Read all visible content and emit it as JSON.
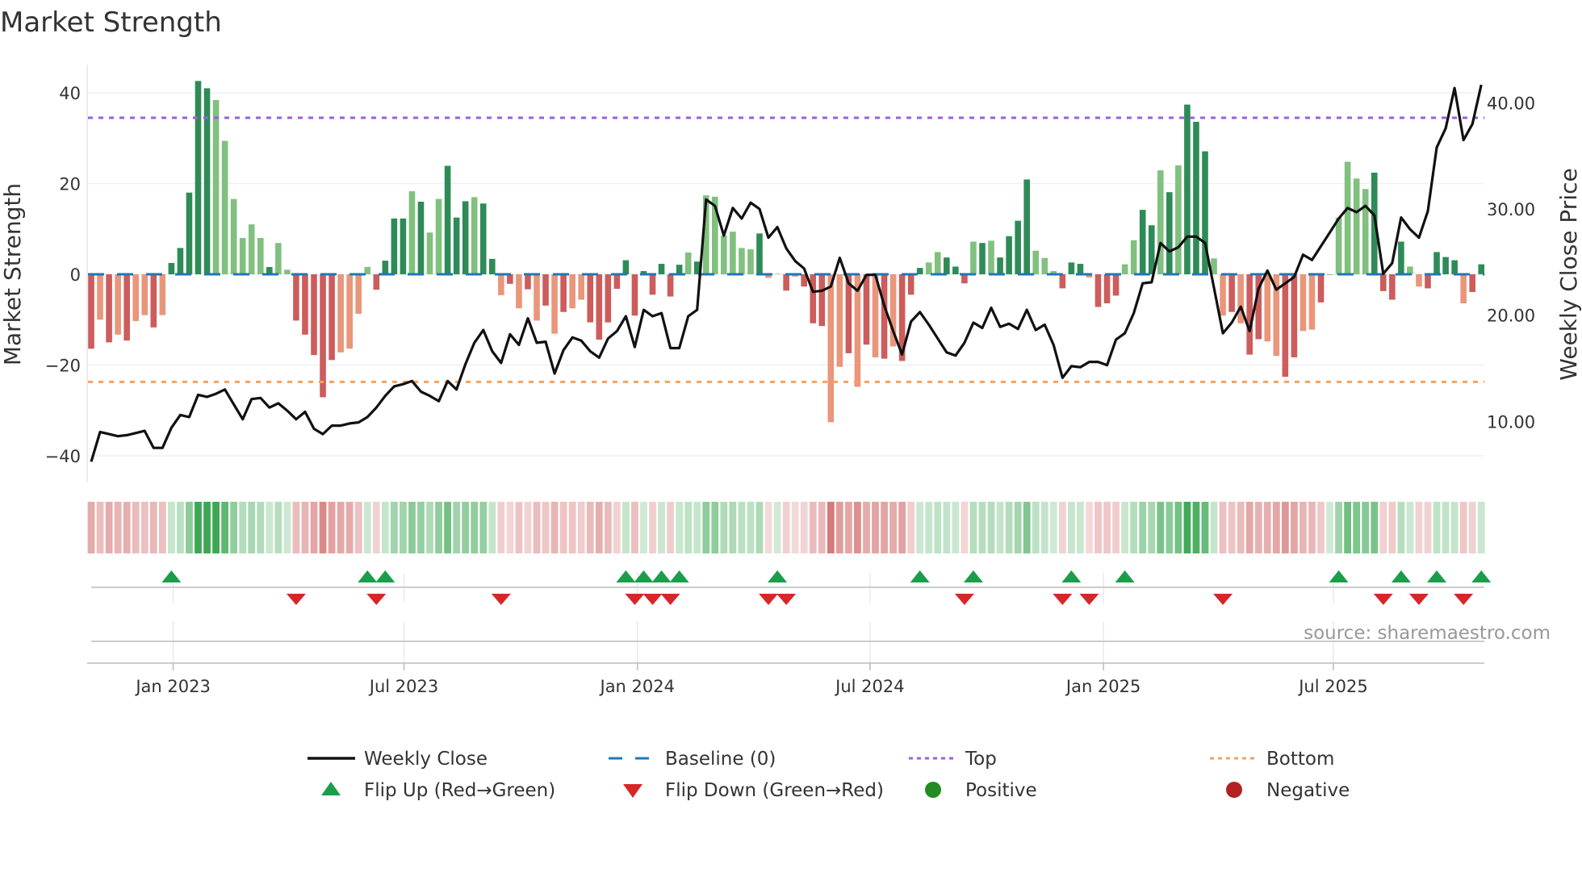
{
  "title": "Market Strength",
  "source": "source: sharemaestro.com",
  "colors": {
    "pos_dark": "#2e8b57",
    "pos_light": "#81c07f",
    "neg_dark": "#cd5c5c",
    "neg_light": "#e9967a",
    "baseline": "#1f77b4",
    "top": "#9b5de5",
    "bottom": "#f4a261",
    "close": "#111111",
    "flip_up": "#1a9e4a",
    "flip_down": "#d62728",
    "positive": "#228b22",
    "negative": "#b22222"
  },
  "chart_data": {
    "type": "bar",
    "title": "Market Strength",
    "ylabel": "Market Strength",
    "y2label": "Weekly Close Price",
    "ylim": [
      -45,
      45
    ],
    "y2lim": [
      5.3,
      48.1
    ],
    "yticks": [
      -40,
      -20,
      0,
      20,
      40
    ],
    "y2ticks": [
      "10.00",
      "20.00",
      "30.00",
      "40.00"
    ],
    "xticks": [
      {
        "label": "Jan 2023",
        "week": 9.2
      },
      {
        "label": "Jul 2023",
        "week": 35.1
      },
      {
        "label": "Jan 2024",
        "week": 61.3
      },
      {
        "label": "Jul 2024",
        "week": 87.4
      },
      {
        "label": "Jan 2025",
        "week": 113.6
      },
      {
        "label": "Jul 2025",
        "week": 139.4
      }
    ],
    "top_level": 34.5,
    "bottom_level": -23.7,
    "baseline": 0,
    "strength": [
      -16.4,
      -10,
      -15,
      -13.3,
      -14.6,
      -10.3,
      -9,
      -11.7,
      -9,
      2.5,
      5.8,
      18,
      42.6,
      41,
      38.4,
      29.4,
      16.6,
      8,
      11,
      8,
      1.6,
      6.9,
      1,
      -10.2,
      -13.3,
      -17.8,
      -27.1,
      -18.9,
      -17.2,
      -16.4,
      -8.7,
      1.6,
      -3.4,
      3,
      12.3,
      12.3,
      18.3,
      16,
      9.2,
      16.6,
      23.9,
      12.5,
      16.1,
      17,
      15.6,
      3.4,
      -4.6,
      -2.1,
      -7.5,
      -3.3,
      -10.2,
      -6.9,
      -13.1,
      -8.3,
      -7.5,
      -5.6,
      -10.6,
      -14.4,
      -10.6,
      -3.2,
      3.1,
      -9.1,
      0.7,
      -4.5,
      2.3,
      -4.9,
      2.1,
      4.8,
      2.8,
      17.4,
      17.1,
      8.5,
      9.4,
      5.8,
      5.5,
      9,
      -0.8,
      0.1,
      -3.6,
      -0.5,
      -2.7,
      -10.8,
      -11.4,
      -32.6,
      -20.4,
      -17.4,
      -24.8,
      -15.5,
      -18.3,
      -18.6,
      -15.9,
      -19.1,
      -4.5,
      1.4,
      2.6,
      4.9,
      3.7,
      1.7,
      -2,
      7.2,
      6.9,
      7.4,
      3.7,
      8.4,
      11.8,
      20.9,
      5.2,
      3.6,
      0.7,
      -3.1,
      2.6,
      2.3,
      -0.7,
      -7.2,
      -6.4,
      -4.7,
      2.2,
      7.5,
      14.2,
      10.8,
      22.9,
      18.1,
      24,
      37.4,
      33.6,
      27.1,
      3.5,
      -9.1,
      -8.3,
      -10.8,
      -17.7,
      -14.3,
      -14.8,
      -18,
      -22.6,
      -18.3,
      -12.5,
      -12.2,
      -6.2,
      0,
      12.5,
      24.8,
      21.1,
      18.8,
      22.4,
      -3.7,
      -5.6,
      7.2,
      1.7,
      -2.7,
      -3.1,
      4.9,
      3.8,
      3.1,
      -6.4,
      -3.9,
      2.2
    ],
    "shade": "dldldlldldddddlllllldlldddddllllddddldlldddlddldldldldlldddddddddddldlllllldlldldddlldldldldddlldddldlddddllldddldddllddldldddlldlddllddllddllllddddllddddlddddlldld",
    "weekly_close": [
      6.2,
      9.0,
      8.8,
      8.6,
      8.7,
      8.9,
      9.1,
      7.5,
      7.5,
      9.4,
      10.6,
      10.4,
      12.5,
      12.3,
      12.6,
      13.0,
      11.6,
      10.2,
      12.1,
      12.2,
      11.3,
      11.7,
      11.0,
      10.2,
      10.9,
      9.3,
      8.8,
      9.6,
      9.6,
      9.8,
      9.9,
      10.4,
      11.3,
      12.4,
      13.3,
      13.5,
      13.8,
      12.8,
      12.4,
      11.9,
      13.8,
      13.0,
      15.4,
      17.4,
      18.6,
      16.6,
      15.5,
      18.2,
      17.2,
      19.7,
      17.4,
      17.5,
      14.5,
      16.7,
      17.9,
      17.6,
      16.6,
      16.0,
      17.8,
      18.5,
      19.9,
      17.0,
      20.5,
      19.9,
      20.2,
      16.9,
      16.9,
      19.9,
      20.5,
      30.9,
      30.3,
      27.5,
      30.1,
      29.1,
      30.6,
      30.0,
      27.3,
      28.3,
      26.3,
      25.1,
      24.4,
      22.2,
      22.3,
      22.7,
      25.4,
      23.0,
      22.3,
      23.8,
      23.8,
      20.9,
      18.5,
      16.3,
      19.4,
      20.3,
      19.1,
      17.8,
      16.5,
      16.2,
      17.4,
      19.3,
      18.8,
      20.7,
      18.9,
      19.2,
      18.7,
      20.5,
      18.6,
      19.1,
      17.2,
      14.1,
      15.2,
      15.1,
      15.6,
      15.6,
      15.3,
      17.7,
      18.3,
      20.2,
      23.0,
      23.1,
      26.8,
      26.0,
      26.4,
      27.4,
      27.4,
      26.8,
      22.6,
      18.3,
      19.3,
      20.8,
      18.5,
      22.5,
      24.2,
      22.4,
      23.0,
      23.6,
      25.7,
      25.2,
      26.5,
      27.8,
      29.1,
      30.1,
      29.7,
      30.3,
      29.4,
      23.9,
      24.9,
      29.2,
      28.1,
      27.3,
      29.8,
      35.8,
      37.6,
      41.4,
      36.5,
      38.0,
      41.7
    ],
    "flip_up_weeks": [
      10,
      32,
      34,
      61,
      63,
      65,
      67,
      78,
      94,
      100,
      111,
      117,
      141,
      148,
      152,
      157
    ],
    "flip_down_weeks": [
      24,
      33,
      47,
      62,
      64,
      66,
      77,
      79,
      99,
      110,
      113,
      128,
      146,
      150,
      155
    ],
    "legend_position": "bottom"
  },
  "legend": {
    "close": "Weekly Close",
    "baseline": "Baseline (0)",
    "top": "Top",
    "bottom": "Bottom",
    "flip_up": "Flip Up (Red→Green)",
    "flip_down": "Flip Down (Green→Red)",
    "positive": "Positive",
    "negative": "Negative"
  }
}
